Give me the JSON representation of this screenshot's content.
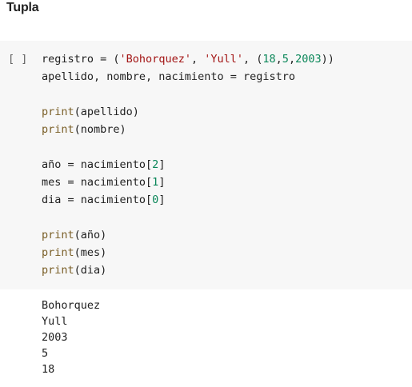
{
  "heading": "Tupla",
  "cell": {
    "run_label": "[ ]",
    "code_lines": [
      [
        [
          "t",
          "registro = ("
        ],
        [
          "s",
          "'Bohorquez'"
        ],
        [
          "t",
          ", "
        ],
        [
          "s",
          "'Yull'"
        ],
        [
          "t",
          ", ("
        ],
        [
          "n",
          "18"
        ],
        [
          "t",
          ","
        ],
        [
          "n",
          "5"
        ],
        [
          "t",
          ","
        ],
        [
          "n",
          "2003"
        ],
        [
          "t",
          "))"
        ]
      ],
      [
        [
          "t",
          "apellido, nombre, nacimiento = registro"
        ]
      ],
      [],
      [
        [
          "f",
          "print"
        ],
        [
          "t",
          "(apellido)"
        ]
      ],
      [
        [
          "f",
          "print"
        ],
        [
          "t",
          "(nombre)"
        ]
      ],
      [],
      [
        [
          "t",
          "año = nacimiento["
        ],
        [
          "n",
          "2"
        ],
        [
          "t",
          "]"
        ]
      ],
      [
        [
          "t",
          "mes = nacimiento["
        ],
        [
          "n",
          "1"
        ],
        [
          "t",
          "]"
        ]
      ],
      [
        [
          "t",
          "dia = nacimiento["
        ],
        [
          "n",
          "0"
        ],
        [
          "t",
          "]"
        ]
      ],
      [],
      [
        [
          "f",
          "print"
        ],
        [
          "t",
          "(año)"
        ]
      ],
      [
        [
          "f",
          "print"
        ],
        [
          "t",
          "(mes)"
        ]
      ],
      [
        [
          "f",
          "print"
        ],
        [
          "t",
          "(dia)"
        ]
      ]
    ],
    "output_lines": [
      "Bohorquez",
      "Yull",
      "2003",
      "5",
      "18"
    ]
  }
}
